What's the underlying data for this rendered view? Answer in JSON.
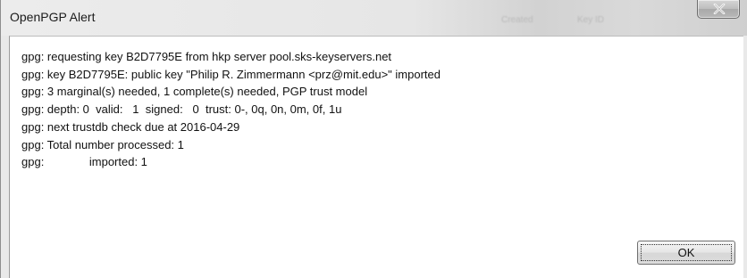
{
  "window": {
    "title": "OpenPGP Alert",
    "background_titles": [
      "Created",
      "Key ID"
    ]
  },
  "close_button": {
    "icon": "close-icon"
  },
  "message_lines": [
    "gpg: requesting key B2D7795E from hkp server pool.sks-keyservers.net",
    "gpg: key B2D7795E: public key \"Philip R. Zimmermann <prz@mit.edu>\" imported",
    "gpg: 3 marginal(s) needed, 1 complete(s) needed, PGP trust model",
    "gpg: depth: 0  valid:   1  signed:   0  trust: 0-, 0q, 0n, 0m, 0f, 1u",
    "gpg: next trustdb check due at 2016-04-29",
    "gpg: Total number processed: 1",
    "gpg:              imported: 1"
  ],
  "buttons": {
    "ok_label": "OK"
  }
}
